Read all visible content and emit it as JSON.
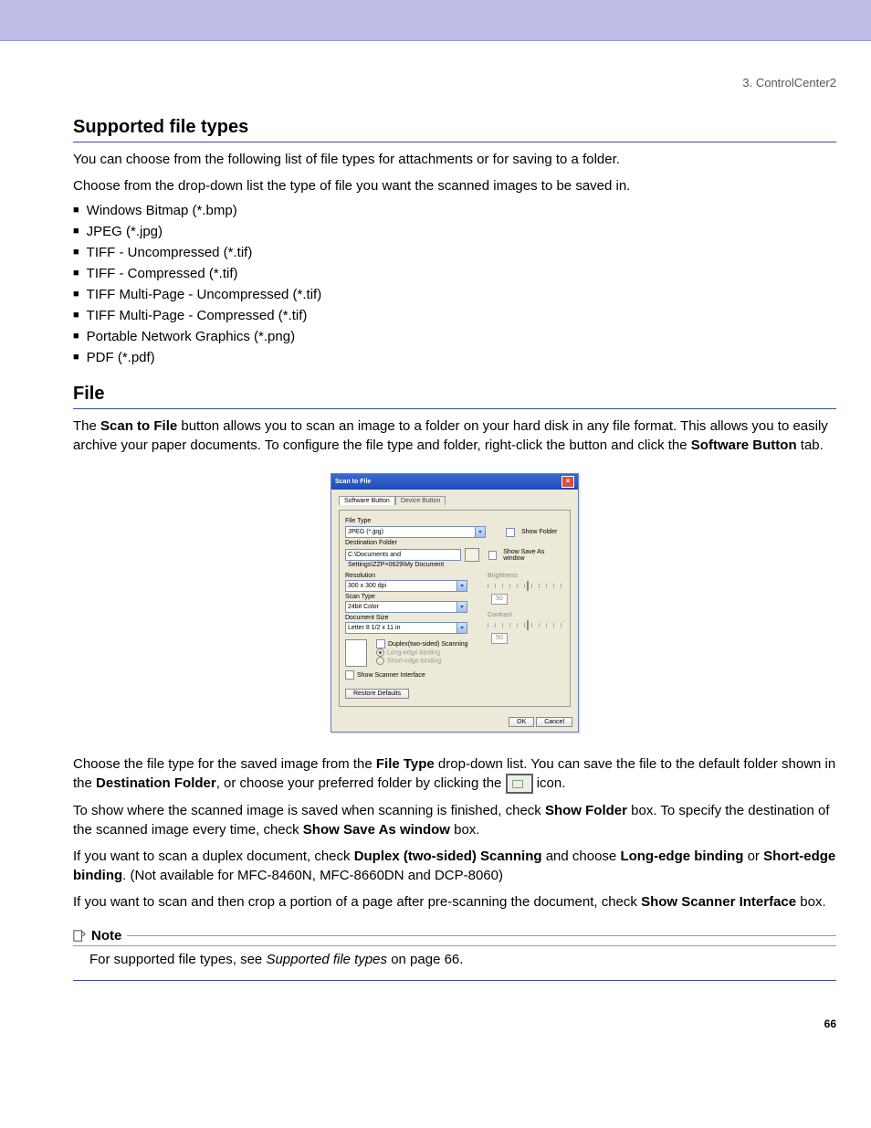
{
  "breadcrumb": "3. ControlCenter2",
  "section1": {
    "title": "Supported file types",
    "p1": "You can choose from the following list of file types for attachments or for saving to a folder.",
    "p2": "Choose from the drop-down list the type of file you want the scanned images to be saved in.",
    "items": [
      "Windows Bitmap (*.bmp)",
      "JPEG (*.jpg)",
      "TIFF - Uncompressed (*.tif)",
      "TIFF - Compressed (*.tif)",
      "TIFF Multi-Page - Uncompressed (*.tif)",
      "TIFF Multi-Page - Compressed (*.tif)",
      "Portable Network Graphics (*.png)",
      "PDF (*.pdf)"
    ]
  },
  "section2": {
    "title": "File",
    "para1_a": "The ",
    "para1_b": "Scan to File",
    "para1_c": " button allows you to scan an image to a folder on your hard disk in any file format. This allows you to easily archive your paper documents. To configure the file type and folder, right-click the button and click the ",
    "para1_d": "Software Button",
    "para1_e": " tab.",
    "dialog": {
      "title": "Scan to File",
      "tabs": {
        "software": "Software Button",
        "device": "Device Button"
      },
      "fileType_lbl": "File Type",
      "fileType_val": "JPEG (*.jpg)",
      "destFolder_lbl": "Destination Folder",
      "destFolder_val": "C:\\Documents and Settings\\ZZP×0629\\My Document",
      "showFolder": "Show Folder",
      "showSaveAs": "Show Save As window",
      "resolution_lbl": "Resolution",
      "resolution_val": "300 x 300 dpi",
      "scanType_lbl": "Scan Type",
      "scanType_val": "24bit Color",
      "docSize_lbl": "Document Size",
      "docSize_val": "Letter 8 1/2 x 11 in",
      "brightness_lbl": "Brightness",
      "brightness_val": "50",
      "contrast_lbl": "Contrast",
      "contrast_val": "50",
      "duplex": "Duplex(two-sided) Scanning",
      "longedge": "Long-edge binding",
      "shortedge": "Short-edge binding",
      "showScanner": "Show Scanner Interface",
      "restore": "Restore Defaults",
      "ok": "OK",
      "cancel": "Cancel"
    },
    "para2_a": "Choose the file type for the saved image from the ",
    "para2_b": "File Type",
    "para2_c": " drop-down list. You can save the file to the default folder shown in the ",
    "para2_d": "Destination Folder",
    "para2_e": ", or choose your preferred folder by clicking the ",
    "para2_f": " icon.",
    "para3_a": "To show where the scanned image is saved when scanning is finished, check ",
    "para3_b": "Show Folder",
    "para3_c": " box. To specify the destination of the scanned image every time, check ",
    "para3_d": "Show Save As window",
    "para3_e": " box.",
    "para4_a": "If you want to scan a duplex document, check ",
    "para4_b": "Duplex (two-sided) Scanning",
    "para4_c": " and choose ",
    "para4_d": "Long-edge binding",
    "para4_e": " or ",
    "para4_f": "Short-edge binding",
    "para4_g": ". (Not available for MFC-8460N, MFC-8660DN and DCP-8060)",
    "para5_a": "If you want to scan and then crop a portion of a page after pre-scanning the document, check ",
    "para5_b": "Show Scanner Interface",
    "para5_c": " box."
  },
  "note": {
    "label": "Note",
    "body_a": "For supported file types, see ",
    "body_b": "Supported file types",
    "body_c": " on page 66."
  },
  "pagenum": "66"
}
